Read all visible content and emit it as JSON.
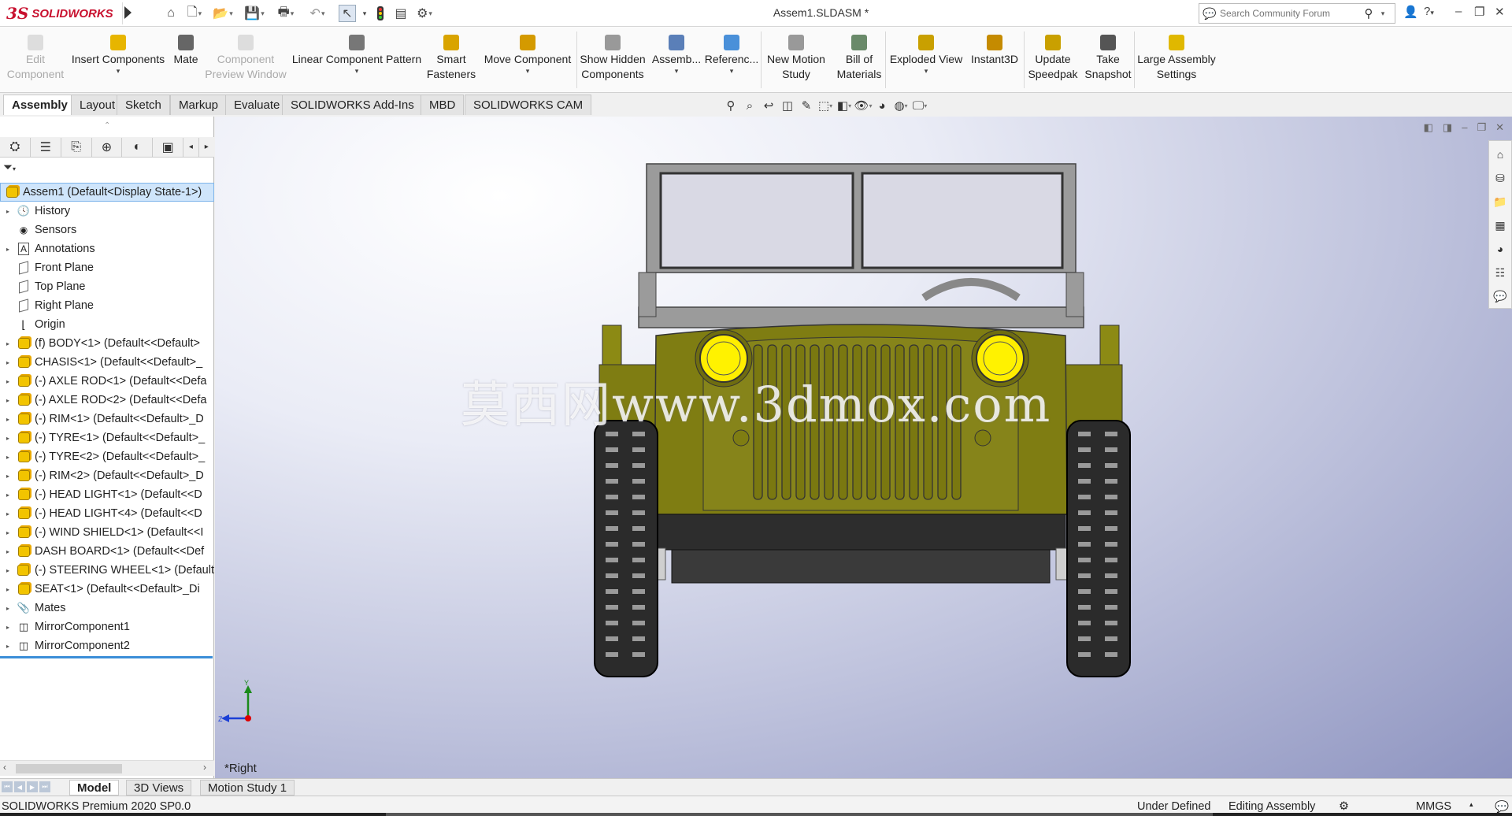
{
  "app": {
    "logo_ds": "3S",
    "logo_name": "SOLIDWORKS",
    "document_title": "Assem1.SLDASM *"
  },
  "search": {
    "placeholder": "Search Community Forum"
  },
  "command_manager": {
    "buttons": [
      {
        "label": "Edit Component",
        "disabled": true,
        "icon": "edit-component-icon"
      },
      {
        "label": "Insert Components",
        "disabled": false,
        "icon": "insert-components-icon"
      },
      {
        "label": "Mate",
        "disabled": false,
        "icon": "mate-paperclip-icon"
      },
      {
        "label": "Component Preview Window",
        "disabled": true,
        "icon": "component-preview-icon"
      },
      {
        "label": "Linear Component Pattern",
        "disabled": false,
        "icon": "linear-pattern-icon"
      },
      {
        "label": "Smart Fasteners",
        "disabled": false,
        "icon": "smart-fasteners-icon"
      },
      {
        "label": "Move Component",
        "disabled": false,
        "icon": "move-component-icon"
      },
      {
        "label": "Show Hidden Components",
        "disabled": false,
        "icon": "show-hidden-icon"
      },
      {
        "label": "Assemb...",
        "disabled": false,
        "icon": "assembly-features-icon"
      },
      {
        "label": "Referenc...",
        "disabled": false,
        "icon": "reference-geometry-icon"
      },
      {
        "label": "New Motion Study",
        "disabled": false,
        "icon": "motion-study-icon"
      },
      {
        "label": "Bill of Materials",
        "disabled": false,
        "icon": "bom-icon"
      },
      {
        "label": "Exploded View",
        "disabled": false,
        "icon": "exploded-view-icon"
      },
      {
        "label": "Instant3D",
        "disabled": false,
        "icon": "instant3d-icon"
      },
      {
        "label": "Update Speedpak",
        "disabled": false,
        "icon": "speedpak-icon"
      },
      {
        "label": "Take Snapshot",
        "disabled": false,
        "icon": "snapshot-camera-icon"
      },
      {
        "label": "Large Assembly Settings",
        "disabled": false,
        "icon": "large-assembly-icon"
      }
    ]
  },
  "tabs": [
    "Assembly",
    "Layout",
    "Sketch",
    "Markup",
    "Evaluate",
    "SOLIDWORKS Add-Ins",
    "MBD",
    "SOLIDWORKS CAM"
  ],
  "active_tab": "Assembly",
  "feature_tree": {
    "root": "Assem1  (Default<Display State-1>)",
    "items": [
      {
        "label": "History",
        "icon": "history-icon",
        "expandable": true
      },
      {
        "label": "Sensors",
        "icon": "sensors-icon",
        "expandable": false
      },
      {
        "label": "Annotations",
        "icon": "annotations-icon",
        "expandable": true
      },
      {
        "label": "Front Plane",
        "icon": "plane-icon",
        "expandable": false
      },
      {
        "label": "Top Plane",
        "icon": "plane-icon",
        "expandable": false
      },
      {
        "label": "Right Plane",
        "icon": "plane-icon",
        "expandable": false
      },
      {
        "label": "Origin",
        "icon": "origin-icon",
        "expandable": false
      },
      {
        "label": "(f) BODY<1> (Default<<Default>",
        "icon": "part-icon",
        "expandable": true
      },
      {
        "label": "CHASIS<1> (Default<<Default>_",
        "icon": "part-icon",
        "expandable": true
      },
      {
        "label": "(-) AXLE ROD<1> (Default<<Defa",
        "icon": "part-icon",
        "expandable": true
      },
      {
        "label": "(-) AXLE ROD<2> (Default<<Defa",
        "icon": "part-icon",
        "expandable": true
      },
      {
        "label": "(-) RIM<1> (Default<<Default>_D",
        "icon": "part-icon",
        "expandable": true
      },
      {
        "label": "(-) TYRE<1> (Default<<Default>_",
        "icon": "part-icon",
        "expandable": true
      },
      {
        "label": "(-) TYRE<2> (Default<<Default>_",
        "icon": "part-icon",
        "expandable": true
      },
      {
        "label": "(-) RIM<2> (Default<<Default>_D",
        "icon": "part-icon",
        "expandable": true
      },
      {
        "label": "(-) HEAD LIGHT<1> (Default<<D",
        "icon": "part-icon",
        "expandable": true
      },
      {
        "label": "(-) HEAD LIGHT<4> (Default<<D",
        "icon": "part-icon",
        "expandable": true
      },
      {
        "label": "(-) WIND SHIELD<1> (Default<<I",
        "icon": "part-icon",
        "expandable": true
      },
      {
        "label": "DASH BOARD<1> (Default<<Def",
        "icon": "part-icon",
        "expandable": true
      },
      {
        "label": "(-) STEERING WHEEL<1> (Default",
        "icon": "part-icon",
        "expandable": true
      },
      {
        "label": "SEAT<1> (Default<<Default>_Di",
        "icon": "part-icon",
        "expandable": true
      },
      {
        "label": "Mates",
        "icon": "mates-icon",
        "expandable": true
      },
      {
        "label": "MirrorComponent1",
        "icon": "mirror-icon",
        "expandable": true
      },
      {
        "label": "MirrorComponent2",
        "icon": "mirror-icon",
        "expandable": true
      }
    ]
  },
  "viewport": {
    "view_name": "*Right",
    "watermark": "莫西网www.3dmox.com",
    "triad_y": "Y",
    "triad_z": "Z"
  },
  "bottom_tabs": [
    "Model",
    "3D Views",
    "Motion Study 1"
  ],
  "active_bottom_tab": "Model",
  "status": {
    "product": "SOLIDWORKS Premium 2020 SP0.0",
    "definition": "Under Defined",
    "mode": "Editing Assembly",
    "units": "MMGS"
  },
  "colors": {
    "accent_red": "#c8102e",
    "jeep_body": "#7f7d12",
    "headlight": "#ffee00",
    "frame_grey": "#9a9a9a",
    "tree_selection": "#cfe5fb"
  }
}
